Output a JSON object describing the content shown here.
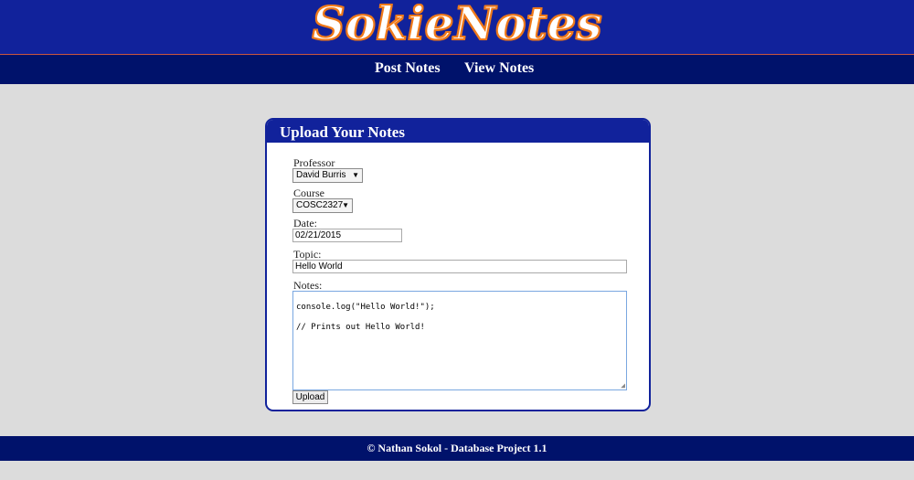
{
  "header": {
    "logo_text": "SokieNotes"
  },
  "nav": {
    "post_notes": "Post Notes",
    "view_notes": "View Notes"
  },
  "form": {
    "title": "Upload Your Notes",
    "professor_label": "Professor",
    "professor_value": "David Burris",
    "course_label": "Course",
    "course_value": "COSC2327",
    "date_label": "Date:",
    "date_value": "02/21/2015",
    "topic_label": "Topic:",
    "topic_value": "Hello World",
    "notes_label": "Notes:",
    "notes_lines": [
      "console.log(\"Hello World!\");",
      "",
      "// Prints out Hello World!"
    ],
    "upload_label": "Upload"
  },
  "footer": {
    "text": "© Nathan Sokol - Database Project 1.1"
  },
  "colors": {
    "header_bg": "#11229b",
    "nav_bg": "#00126b",
    "page_bg": "#dcdcdc",
    "logo_outline": "#f07a1a"
  }
}
